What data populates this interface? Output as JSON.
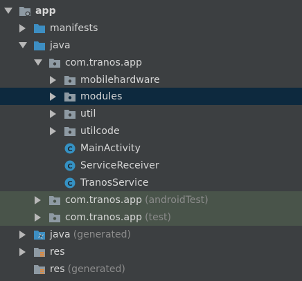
{
  "tree": {
    "app": "app",
    "manifests": "manifests",
    "java": "java",
    "package": "com.tranos.app",
    "mobilehardware": "mobilehardware",
    "modules": "modules",
    "util": "util",
    "utilcode": "utilcode",
    "main_activity": "MainActivity",
    "service_receiver": "ServiceReceiver",
    "tranos_service": "TranosService",
    "package_android_test": "com.tranos.app",
    "android_test_suffix": "(androidTest)",
    "package_test": "com.tranos.app",
    "test_suffix": "(test)",
    "java_generated": "java",
    "java_generated_suffix": "(generated)",
    "res": "res",
    "res_generated": "res",
    "res_generated_suffix": "(generated)"
  },
  "colors": {
    "background": "#3c3f41",
    "selected_row": "#0d293e",
    "test_row": "#49544a",
    "folder_blue": "#3d8ec2",
    "class_badge": "#3592c4",
    "suffix_text": "#8c8c8c"
  }
}
